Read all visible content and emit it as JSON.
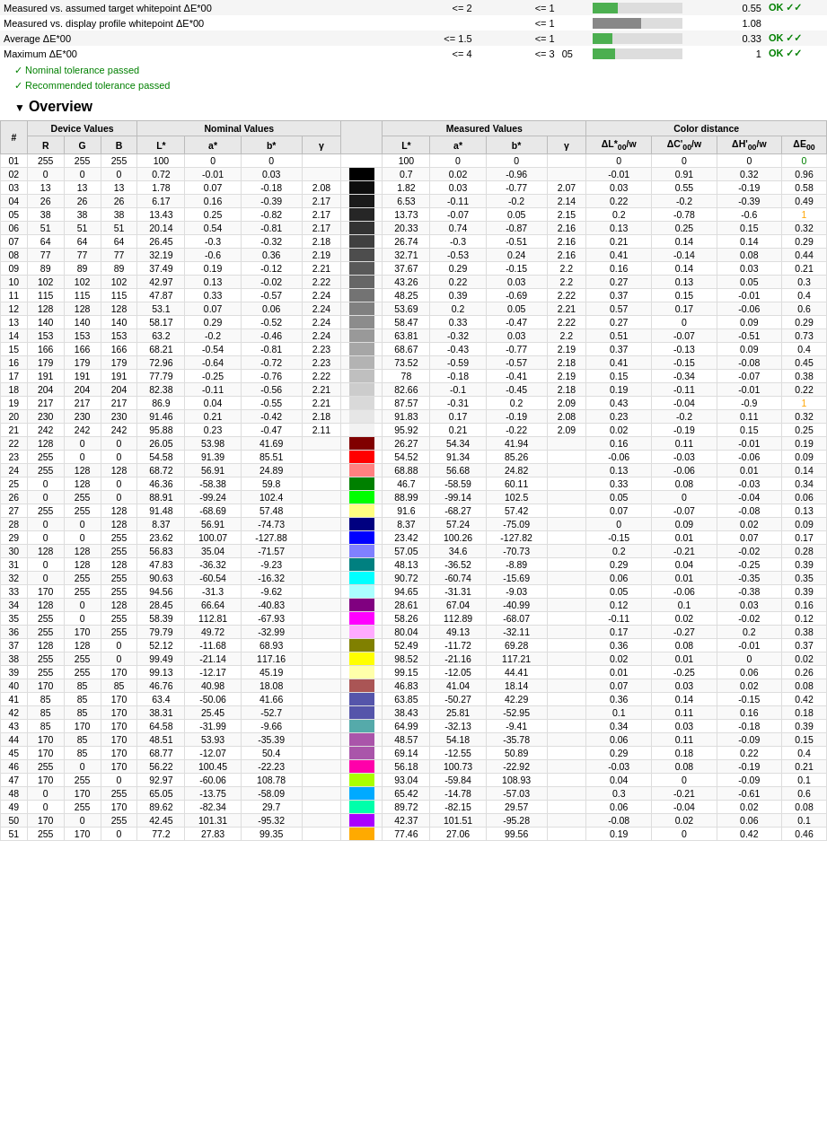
{
  "header_rows": [
    {
      "label": "Measured vs. assumed target whitepoint ΔE*00",
      "tolerance1": "<= 2",
      "tolerance2": "<= 1",
      "value": "0.55",
      "bar_pct": 28,
      "bar_color": "green",
      "status": "OK ✓✓",
      "status_color": "green"
    },
    {
      "label": "Measured vs. display profile whitepoint ΔE*00",
      "tolerance1": "",
      "tolerance2": "<= 1",
      "value": "1.08",
      "bar_pct": 54,
      "bar_color": "gray",
      "status": "",
      "status_color": ""
    },
    {
      "label": "Average ΔE*00",
      "tolerance1": "<= 1.5",
      "tolerance2": "<= 1",
      "value": "0.33",
      "bar_pct": 22,
      "bar_color": "green",
      "status": "OK ✓✓",
      "status_color": "green"
    },
    {
      "label": "Maximum ΔE*00",
      "tolerance1": "<= 4",
      "tolerance2": "<= 3",
      "value": "1",
      "bar_pct": 25,
      "bar_color": "green",
      "status": "OK ✓✓",
      "status_color": "green",
      "extra": "05"
    }
  ],
  "tolerance_lines": [
    "✓ Nominal tolerance passed",
    "✓ Recommended tolerance passed"
  ],
  "overview_title": "Overview",
  "table_headers": {
    "num": "#",
    "device": "Device Values",
    "nominal": "Nominal Values",
    "measured": "Measured Values",
    "color_distance": "Color distance"
  },
  "sub_headers": {
    "R": "R",
    "G": "G",
    "B": "B",
    "L_nom": "L*",
    "a_nom": "a*",
    "b_nom": "b*",
    "gamma_nom": "γ",
    "swatch": "",
    "L_meas": "L*",
    "a_meas": "a*",
    "b_meas": "b*",
    "gamma_meas": "γ",
    "dL": "ΔL*00/w",
    "dC": "ΔC'00/w",
    "dH": "ΔH'00/w",
    "dE": "ΔE00"
  },
  "rows": [
    {
      "num": "01",
      "R": 255,
      "G": 255,
      "B": 255,
      "Ln": 100,
      "an": 0,
      "bn": 0,
      "gn": null,
      "swatch": "#ffffff",
      "Lm": 100,
      "am": 0,
      "bm": 0,
      "gm": null,
      "dL": 0,
      "dC": 0,
      "dH": 0,
      "dE": "0",
      "dE_color": "green"
    },
    {
      "num": "02",
      "R": 0,
      "G": 0,
      "B": 0,
      "Ln": 0.72,
      "an": -0.01,
      "bn": 0.03,
      "gn": null,
      "swatch": "#000000",
      "Lm": 0.7,
      "am": 0.02,
      "bm": -0.96,
      "gm": null,
      "dL": -0.01,
      "dC": 0.91,
      "dH": 0.32,
      "dE": "0.96",
      "dE_color": "black"
    },
    {
      "num": "03",
      "R": 13,
      "G": 13,
      "B": 13,
      "Ln": 1.78,
      "an": 0.07,
      "bn": -0.18,
      "gn": 2.08,
      "swatch": "#0d0d0d",
      "Lm": 1.82,
      "am": 0.03,
      "bm": -0.77,
      "gm": 2.07,
      "dL": 0.03,
      "dC": 0.55,
      "dH": -0.19,
      "dE": "0.58",
      "dE_color": "black"
    },
    {
      "num": "04",
      "R": 26,
      "G": 26,
      "B": 26,
      "Ln": 6.17,
      "an": 0.16,
      "bn": -0.39,
      "gn": 2.17,
      "swatch": "#1a1a1a",
      "Lm": 6.53,
      "am": -0.11,
      "bm": -0.2,
      "gm": 2.14,
      "dL": 0.22,
      "dC": -0.2,
      "dH": -0.39,
      "dE": "0.49",
      "dE_color": "black"
    },
    {
      "num": "05",
      "R": 38,
      "G": 38,
      "B": 38,
      "Ln": 13.43,
      "an": 0.25,
      "bn": -0.82,
      "gn": 2.17,
      "swatch": "#262626",
      "Lm": 13.73,
      "am": -0.07,
      "bm": 0.05,
      "gm": 2.15,
      "dL": 0.2,
      "dC": -0.78,
      "dH": -0.6,
      "dE": "1",
      "dE_color": "orange"
    },
    {
      "num": "06",
      "R": 51,
      "G": 51,
      "B": 51,
      "Ln": 20.14,
      "an": 0.54,
      "bn": -0.81,
      "gn": 2.17,
      "swatch": "#333333",
      "Lm": 20.33,
      "am": 0.74,
      "bm": -0.87,
      "gm": 2.16,
      "dL": 0.13,
      "dC": 0.25,
      "dH": 0.15,
      "dE": "0.32",
      "dE_color": "black"
    },
    {
      "num": "07",
      "R": 64,
      "G": 64,
      "B": 64,
      "Ln": 26.45,
      "an": -0.3,
      "bn": -0.32,
      "gn": 2.18,
      "swatch": "#404040",
      "Lm": 26.74,
      "am": -0.3,
      "bm": -0.51,
      "gm": 2.16,
      "dL": 0.21,
      "dC": 0.14,
      "dH": 0.14,
      "dE": "0.29",
      "dE_color": "black"
    },
    {
      "num": "08",
      "R": 77,
      "G": 77,
      "B": 77,
      "Ln": 32.19,
      "an": -0.6,
      "bn": 0.36,
      "gn": 2.19,
      "swatch": "#4d4d4d",
      "Lm": 32.71,
      "am": -0.53,
      "bm": 0.24,
      "gm": 2.16,
      "dL": 0.41,
      "dC": -0.14,
      "dH": 0.08,
      "dE": "0.44",
      "dE_color": "black"
    },
    {
      "num": "09",
      "R": 89,
      "G": 89,
      "B": 89,
      "Ln": 37.49,
      "an": 0.19,
      "bn": -0.12,
      "gn": 2.21,
      "swatch": "#595959",
      "Lm": 37.67,
      "am": 0.29,
      "bm": -0.15,
      "gm": 2.2,
      "dL": 0.16,
      "dC": 0.14,
      "dH": 0.03,
      "dE": "0.21",
      "dE_color": "black"
    },
    {
      "num": "10",
      "R": 102,
      "G": 102,
      "B": 102,
      "Ln": 42.97,
      "an": 0.13,
      "bn": -0.02,
      "gn": 2.22,
      "swatch": "#666666",
      "Lm": 43.26,
      "am": 0.22,
      "bm": 0.03,
      "gm": 2.2,
      "dL": 0.27,
      "dC": 0.13,
      "dH": 0.05,
      "dE": "0.3",
      "dE_color": "black"
    },
    {
      "num": "11",
      "R": 115,
      "G": 115,
      "B": 115,
      "Ln": 47.87,
      "an": 0.33,
      "bn": -0.57,
      "gn": 2.24,
      "swatch": "#737373",
      "Lm": 48.25,
      "am": 0.39,
      "bm": -0.69,
      "gm": 2.22,
      "dL": 0.37,
      "dC": 0.15,
      "dH": -0.01,
      "dE": "0.4",
      "dE_color": "black"
    },
    {
      "num": "12",
      "R": 128,
      "G": 128,
      "B": 128,
      "Ln": 53.1,
      "an": 0.07,
      "bn": 0.06,
      "gn": 2.24,
      "swatch": "#808080",
      "Lm": 53.69,
      "am": 0.2,
      "bm": 0.05,
      "gm": 2.21,
      "dL": 0.57,
      "dC": 0.17,
      "dH": -0.06,
      "dE": "0.6",
      "dE_color": "black"
    },
    {
      "num": "13",
      "R": 140,
      "G": 140,
      "B": 140,
      "Ln": 58.17,
      "an": 0.29,
      "bn": -0.52,
      "gn": 2.24,
      "swatch": "#8c8c8c",
      "Lm": 58.47,
      "am": 0.33,
      "bm": -0.47,
      "gm": 2.22,
      "dL": 0.27,
      "dC": 0,
      "dH": 0.09,
      "dE": "0.29",
      "dE_color": "black"
    },
    {
      "num": "14",
      "R": 153,
      "G": 153,
      "B": 153,
      "Ln": 63.2,
      "an": -0.2,
      "bn": -0.46,
      "gn": 2.24,
      "swatch": "#999999",
      "Lm": 63.81,
      "am": -0.32,
      "bm": 0.03,
      "gm": 2.2,
      "dL": 0.51,
      "dC": -0.07,
      "dH": -0.51,
      "dE": "0.73",
      "dE_color": "black"
    },
    {
      "num": "15",
      "R": 166,
      "G": 166,
      "B": 166,
      "Ln": 68.21,
      "an": -0.54,
      "bn": -0.81,
      "gn": 2.23,
      "swatch": "#a6a6a6",
      "Lm": 68.67,
      "am": -0.43,
      "bm": -0.77,
      "gm": 2.19,
      "dL": 0.37,
      "dC": -0.13,
      "dH": 0.09,
      "dE": "0.4",
      "dE_color": "black"
    },
    {
      "num": "16",
      "R": 179,
      "G": 179,
      "B": 179,
      "Ln": 72.96,
      "an": -0.64,
      "bn": -0.72,
      "gn": 2.23,
      "swatch": "#b3b3b3",
      "Lm": 73.52,
      "am": -0.59,
      "bm": -0.57,
      "gm": 2.18,
      "dL": 0.41,
      "dC": -0.15,
      "dH": -0.08,
      "dE": "0.45",
      "dE_color": "black"
    },
    {
      "num": "17",
      "R": 191,
      "G": 191,
      "B": 191,
      "Ln": 77.79,
      "an": -0.25,
      "bn": -0.76,
      "gn": 2.22,
      "swatch": "#bfbfbf",
      "Lm": 78,
      "am": -0.18,
      "bm": -0.41,
      "gm": 2.19,
      "dL": 0.15,
      "dC": -0.34,
      "dH": -0.07,
      "dE": "0.38",
      "dE_color": "black"
    },
    {
      "num": "18",
      "R": 204,
      "G": 204,
      "B": 204,
      "Ln": 82.38,
      "an": -0.11,
      "bn": -0.56,
      "gn": 2.21,
      "swatch": "#cccccc",
      "Lm": 82.66,
      "am": -0.1,
      "bm": -0.45,
      "gm": 2.18,
      "dL": 0.19,
      "dC": -0.11,
      "dH": -0.01,
      "dE": "0.22",
      "dE_color": "black"
    },
    {
      "num": "19",
      "R": 217,
      "G": 217,
      "B": 217,
      "Ln": 86.9,
      "an": 0.04,
      "bn": -0.55,
      "gn": 2.21,
      "swatch": "#d9d9d9",
      "Lm": 87.57,
      "am": -0.31,
      "bm": 0.2,
      "gm": 2.09,
      "dL": 0.43,
      "dC": -0.04,
      "dH": -0.9,
      "dE": "1",
      "dE_color": "orange"
    },
    {
      "num": "20",
      "R": 230,
      "G": 230,
      "B": 230,
      "Ln": 91.46,
      "an": 0.21,
      "bn": -0.42,
      "gn": 2.18,
      "swatch": "#e6e6e6",
      "Lm": 91.83,
      "am": 0.17,
      "bm": -0.19,
      "gm": 2.08,
      "dL": 0.23,
      "dC": -0.2,
      "dH": 0.11,
      "dE": "0.32",
      "dE_color": "black"
    },
    {
      "num": "21",
      "R": 242,
      "G": 242,
      "B": 242,
      "Ln": 95.88,
      "an": 0.23,
      "bn": -0.47,
      "gn": 2.11,
      "swatch": "#f2f2f2",
      "Lm": 95.92,
      "am": 0.21,
      "bm": -0.22,
      "gm": 2.09,
      "dL": 0.02,
      "dC": -0.19,
      "dH": 0.15,
      "dE": "0.25",
      "dE_color": "black"
    },
    {
      "num": "22",
      "R": 128,
      "G": 0,
      "B": 0,
      "Ln": 26.05,
      "an": 53.98,
      "bn": 41.69,
      "gn": null,
      "swatch": "#800000",
      "Lm": 26.27,
      "am": 54.34,
      "bm": 41.94,
      "gm": null,
      "dL": 0.16,
      "dC": 0.11,
      "dH": -0.01,
      "dE": "0.19",
      "dE_color": "black"
    },
    {
      "num": "23",
      "R": 255,
      "G": 0,
      "B": 0,
      "Ln": 54.58,
      "an": 91.39,
      "bn": 85.51,
      "gn": null,
      "swatch": "#ff0000",
      "Lm": 54.52,
      "am": 91.34,
      "bm": 85.26,
      "gm": null,
      "dL": -0.06,
      "dC": -0.03,
      "dH": -0.06,
      "dE": "0.09",
      "dE_color": "black"
    },
    {
      "num": "24",
      "R": 255,
      "G": 128,
      "B": 128,
      "Ln": 68.72,
      "an": 56.91,
      "bn": 24.89,
      "gn": null,
      "swatch": "#ff8080",
      "Lm": 68.88,
      "am": 56.68,
      "bm": 24.82,
      "gm": null,
      "dL": 0.13,
      "dC": -0.06,
      "dH": 0.01,
      "dE": "0.14",
      "dE_color": "black"
    },
    {
      "num": "25",
      "R": 0,
      "G": 128,
      "B": 0,
      "Ln": 46.36,
      "an": -58.38,
      "bn": 59.8,
      "gn": null,
      "swatch": "#008000",
      "Lm": 46.7,
      "am": -58.59,
      "bm": 60.11,
      "gm": null,
      "dL": 0.33,
      "dC": 0.08,
      "dH": -0.03,
      "dE": "0.34",
      "dE_color": "black"
    },
    {
      "num": "26",
      "R": 0,
      "G": 255,
      "B": 0,
      "Ln": 88.91,
      "an": -99.24,
      "bn": 102.4,
      "gn": null,
      "swatch": "#00ff00",
      "Lm": 88.99,
      "am": -99.14,
      "bm": 102.5,
      "gm": null,
      "dL": 0.05,
      "dC": 0,
      "dH": -0.04,
      "dE": "0.06",
      "dE_color": "black"
    },
    {
      "num": "27",
      "R": 255,
      "G": 255,
      "B": 128,
      "Ln": 91.48,
      "an": -68.69,
      "bn": 57.48,
      "gn": null,
      "swatch": "#ffff80",
      "Lm": 91.6,
      "am": -68.27,
      "bm": 57.42,
      "gm": null,
      "dL": 0.07,
      "dC": -0.07,
      "dH": -0.08,
      "dE": "0.13",
      "dE_color": "black"
    },
    {
      "num": "28",
      "R": 0,
      "G": 0,
      "B": 128,
      "Ln": 8.37,
      "an": 56.91,
      "bn": -74.73,
      "gn": null,
      "swatch": "#000080",
      "Lm": 8.37,
      "am": 57.24,
      "bm": -75.09,
      "gm": null,
      "dL": 0,
      "dC": 0.09,
      "dH": 0.02,
      "dE": "0.09",
      "dE_color": "black"
    },
    {
      "num": "29",
      "R": 0,
      "G": 0,
      "B": 255,
      "Ln": 23.62,
      "an": 100.07,
      "bn": -127.88,
      "gn": null,
      "swatch": "#0000ff",
      "Lm": 23.42,
      "am": 100.26,
      "bm": -127.82,
      "gm": null,
      "dL": -0.15,
      "dC": 0.01,
      "dH": 0.07,
      "dE": "0.17",
      "dE_color": "black"
    },
    {
      "num": "30",
      "R": 128,
      "G": 128,
      "B": 255,
      "Ln": 56.83,
      "an": 35.04,
      "bn": -71.57,
      "gn": null,
      "swatch": "#8080ff",
      "Lm": 57.05,
      "am": 34.6,
      "bm": -70.73,
      "gm": null,
      "dL": 0.2,
      "dC": -0.21,
      "dH": -0.02,
      "dE": "0.28",
      "dE_color": "black"
    },
    {
      "num": "31",
      "R": 0,
      "G": 128,
      "B": 128,
      "Ln": 47.83,
      "an": -36.32,
      "bn": -9.23,
      "gn": null,
      "swatch": "#008080",
      "Lm": 48.13,
      "am": -36.52,
      "bm": -8.89,
      "gm": null,
      "dL": 0.29,
      "dC": 0.04,
      "dH": -0.25,
      "dE": "0.39",
      "dE_color": "black"
    },
    {
      "num": "32",
      "R": 0,
      "G": 255,
      "B": 255,
      "Ln": 90.63,
      "an": -60.54,
      "bn": -16.32,
      "gn": null,
      "swatch": "#00ffff",
      "Lm": 90.72,
      "am": -60.74,
      "bm": -15.69,
      "gm": null,
      "dL": 0.06,
      "dC": 0.01,
      "dH": -0.35,
      "dE": "0.35",
      "dE_color": "black"
    },
    {
      "num": "33",
      "R": 170,
      "G": 255,
      "B": 255,
      "Ln": 94.56,
      "an": -31.3,
      "bn": -9.62,
      "gn": null,
      "swatch": "#aaffff",
      "Lm": 94.65,
      "am": -31.31,
      "bm": -9.03,
      "gm": null,
      "dL": 0.05,
      "dC": -0.06,
      "dH": -0.38,
      "dE": "0.39",
      "dE_color": "black"
    },
    {
      "num": "34",
      "R": 128,
      "G": 0,
      "B": 128,
      "Ln": 28.45,
      "an": 66.64,
      "bn": -40.83,
      "gn": null,
      "swatch": "#800080",
      "Lm": 28.61,
      "am": 67.04,
      "bm": -40.99,
      "gm": null,
      "dL": 0.12,
      "dC": 0.1,
      "dH": 0.03,
      "dE": "0.16",
      "dE_color": "black"
    },
    {
      "num": "35",
      "R": 255,
      "G": 0,
      "B": 255,
      "Ln": 58.39,
      "an": 112.81,
      "bn": -67.93,
      "gn": null,
      "swatch": "#ff00ff",
      "Lm": 58.26,
      "am": 112.89,
      "bm": -68.07,
      "gm": null,
      "dL": -0.11,
      "dC": 0.02,
      "dH": -0.02,
      "dE": "0.12",
      "dE_color": "black"
    },
    {
      "num": "36",
      "R": 255,
      "G": 170,
      "B": 255,
      "Ln": 79.79,
      "an": 49.72,
      "bn": -32.99,
      "gn": null,
      "swatch": "#ffaaff",
      "Lm": 80.04,
      "am": 49.13,
      "bm": -32.11,
      "gm": null,
      "dL": 0.17,
      "dC": -0.27,
      "dH": 0.2,
      "dE": "0.38",
      "dE_color": "black"
    },
    {
      "num": "37",
      "R": 128,
      "G": 128,
      "B": 0,
      "Ln": 52.12,
      "an": -11.68,
      "bn": 68.93,
      "gn": null,
      "swatch": "#808000",
      "Lm": 52.49,
      "am": -11.72,
      "bm": 69.28,
      "gm": null,
      "dL": 0.36,
      "dC": 0.08,
      "dH": -0.01,
      "dE": "0.37",
      "dE_color": "black"
    },
    {
      "num": "38",
      "R": 255,
      "G": 255,
      "B": 0,
      "Ln": 99.49,
      "an": -21.14,
      "bn": 117.16,
      "gn": null,
      "swatch": "#ffff00",
      "Lm": 98.52,
      "am": -21.16,
      "bm": 117.21,
      "gm": null,
      "dL": 0.02,
      "dC": 0.01,
      "dH": 0,
      "dE": "0.02",
      "dE_color": "black"
    },
    {
      "num": "39",
      "R": 255,
      "G": 255,
      "B": 170,
      "Ln": 99.13,
      "an": -12.17,
      "bn": 45.19,
      "gn": null,
      "swatch": "#ffffaa",
      "Lm": 99.15,
      "am": -12.05,
      "bm": 44.41,
      "gm": null,
      "dL": 0.01,
      "dC": -0.25,
      "dH": 0.06,
      "dE": "0.26",
      "dE_color": "black"
    },
    {
      "num": "40",
      "R": 170,
      "G": 85,
      "B": 85,
      "Ln": 46.76,
      "an": 40.98,
      "bn": 18.08,
      "gn": null,
      "swatch": "#aa5555",
      "Lm": 46.83,
      "am": 41.04,
      "bm": 18.14,
      "gm": null,
      "dL": 0.07,
      "dC": 0.03,
      "dH": 0.02,
      "dE": "0.08",
      "dE_color": "black"
    },
    {
      "num": "41",
      "R": 85,
      "G": 85,
      "B": 170,
      "Ln": 63.4,
      "an": -50.06,
      "bn": 41.66,
      "gn": null,
      "swatch": "#5555aa",
      "Lm": 63.85,
      "am": -50.27,
      "bm": 42.29,
      "gm": null,
      "dL": 0.36,
      "dC": 0.14,
      "dH": -0.15,
      "dE": "0.42",
      "dE_color": "black"
    },
    {
      "num": "42",
      "R": 85,
      "G": 85,
      "B": 170,
      "Ln": 38.31,
      "an": 25.45,
      "bn": -52.7,
      "gn": null,
      "swatch": "#5555aa",
      "Lm": 38.43,
      "am": 25.81,
      "bm": -52.95,
      "gm": null,
      "dL": 0.1,
      "dC": 0.11,
      "dH": 0.16,
      "dE": "0.18",
      "dE_color": "black"
    },
    {
      "num": "43",
      "R": 85,
      "G": 170,
      "B": 170,
      "Ln": 64.58,
      "an": -31.99,
      "bn": -9.66,
      "gn": null,
      "swatch": "#55aaaa",
      "Lm": 64.99,
      "am": -32.13,
      "bm": -9.41,
      "gm": null,
      "dL": 0.34,
      "dC": 0.03,
      "dH": -0.18,
      "dE": "0.39",
      "dE_color": "black"
    },
    {
      "num": "44",
      "R": 170,
      "G": 85,
      "B": 170,
      "Ln": 48.51,
      "an": 53.93,
      "bn": -35.39,
      "gn": null,
      "swatch": "#aa55aa",
      "Lm": 48.57,
      "am": 54.18,
      "bm": -35.78,
      "gm": null,
      "dL": 0.06,
      "dC": 0.11,
      "dH": -0.09,
      "dE": "0.15",
      "dE_color": "black"
    },
    {
      "num": "45",
      "R": 170,
      "G": 85,
      "B": 170,
      "Ln": 68.77,
      "an": -12.07,
      "bn": 50.4,
      "gn": null,
      "swatch": "#aa55aa",
      "Lm": 69.14,
      "am": -12.55,
      "bm": 50.89,
      "gm": null,
      "dL": 0.29,
      "dC": 0.18,
      "dH": 0.22,
      "dE": "0.4",
      "dE_color": "black"
    },
    {
      "num": "46",
      "R": 255,
      "G": 0,
      "B": 170,
      "Ln": 56.22,
      "an": 100.45,
      "bn": -22.23,
      "gn": null,
      "swatch": "#ff00aa",
      "Lm": 56.18,
      "am": 100.73,
      "bm": -22.92,
      "gm": null,
      "dL": -0.03,
      "dC": 0.08,
      "dH": -0.19,
      "dE": "0.21",
      "dE_color": "black"
    },
    {
      "num": "47",
      "R": 170,
      "G": 255,
      "B": 0,
      "Ln": 92.97,
      "an": -60.06,
      "bn": 108.78,
      "gn": null,
      "swatch": "#aaff00",
      "Lm": 93.04,
      "am": -59.84,
      "bm": 108.93,
      "gm": null,
      "dL": 0.04,
      "dC": 0,
      "dH": -0.09,
      "dE": "0.1",
      "dE_color": "black"
    },
    {
      "num": "48",
      "R": 0,
      "G": 170,
      "B": 255,
      "Ln": 65.05,
      "an": -13.75,
      "bn": -58.09,
      "gn": null,
      "swatch": "#00aaff",
      "Lm": 65.42,
      "am": -14.78,
      "bm": -57.03,
      "gm": null,
      "dL": 0.3,
      "dC": -0.21,
      "dH": -0.61,
      "dE": "0.6",
      "dE_color": "black"
    },
    {
      "num": "49",
      "R": 0,
      "G": 255,
      "B": 170,
      "Ln": 89.62,
      "an": -82.34,
      "bn": 29.7,
      "gn": null,
      "swatch": "#00ffaa",
      "Lm": 89.72,
      "am": -82.15,
      "bm": 29.57,
      "gm": null,
      "dL": 0.06,
      "dC": -0.04,
      "dH": 0.02,
      "dE": "0.08",
      "dE_color": "black"
    },
    {
      "num": "50",
      "R": 170,
      "G": 0,
      "B": 255,
      "Ln": 42.45,
      "an": 101.31,
      "bn": -95.32,
      "gn": null,
      "swatch": "#aa00ff",
      "Lm": 42.37,
      "am": 101.51,
      "bm": -95.28,
      "gm": null,
      "dL": -0.08,
      "dC": 0.02,
      "dH": 0.06,
      "dE": "0.1",
      "dE_color": "black"
    },
    {
      "num": "51",
      "R": 255,
      "G": 170,
      "B": 0,
      "Ln": 77.2,
      "an": 27.83,
      "bn": 99.35,
      "gn": null,
      "swatch": "#ffaa00",
      "Lm": 77.46,
      "am": 27.06,
      "bm": 99.56,
      "gm": null,
      "dL": 0.19,
      "dC": 0,
      "dH": 0.42,
      "dE": "0.46",
      "dE_color": "black"
    }
  ]
}
